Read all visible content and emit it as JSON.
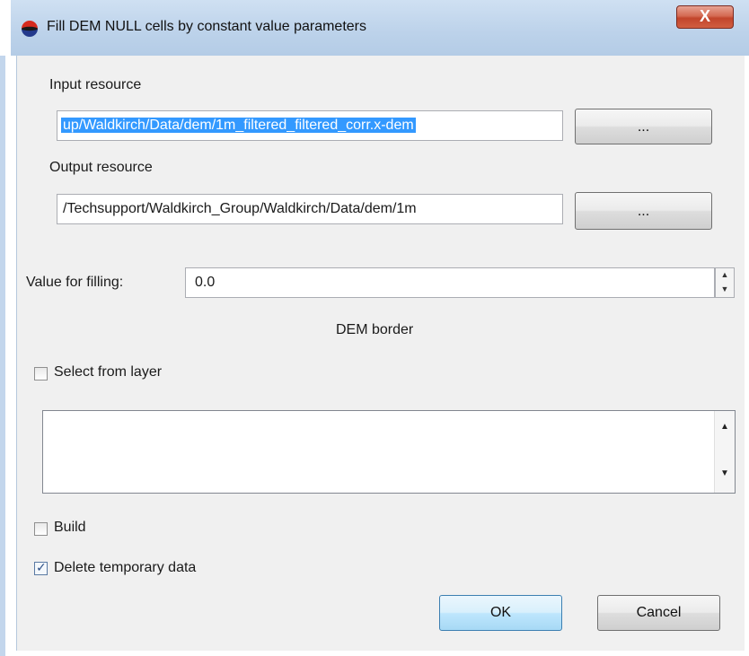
{
  "window": {
    "title": "Fill DEM NULL cells by constant value parameters",
    "close_glyph": "X",
    "app_icon": "dem-app-icon"
  },
  "input_resource": {
    "label": "Input resource",
    "value": "up/Waldkirch/Data/dem/1m_filtered_filtered_corr.x-dem",
    "browse_label": "..."
  },
  "output_resource": {
    "label": "Output resource",
    "value": "/Techsupport/Waldkirch_Group/Waldkirch/Data/dem/1m",
    "browse_label": "..."
  },
  "filling": {
    "label": "Value for filling:",
    "value": "0.0"
  },
  "dem_border": {
    "heading": "DEM border",
    "select_from_layer_label": "Select from layer",
    "select_from_layer_checked": false
  },
  "build": {
    "label": "Build",
    "checked": false
  },
  "delete_temp": {
    "label": "Delete temporary data",
    "checked": true
  },
  "buttons": {
    "ok": "OK",
    "cancel": "Cancel"
  },
  "colors": {
    "title_bar": "#bcd2ea",
    "selection": "#3399ff",
    "dialog_bg": "#f0f0f0",
    "close_button": "#c2452c"
  }
}
